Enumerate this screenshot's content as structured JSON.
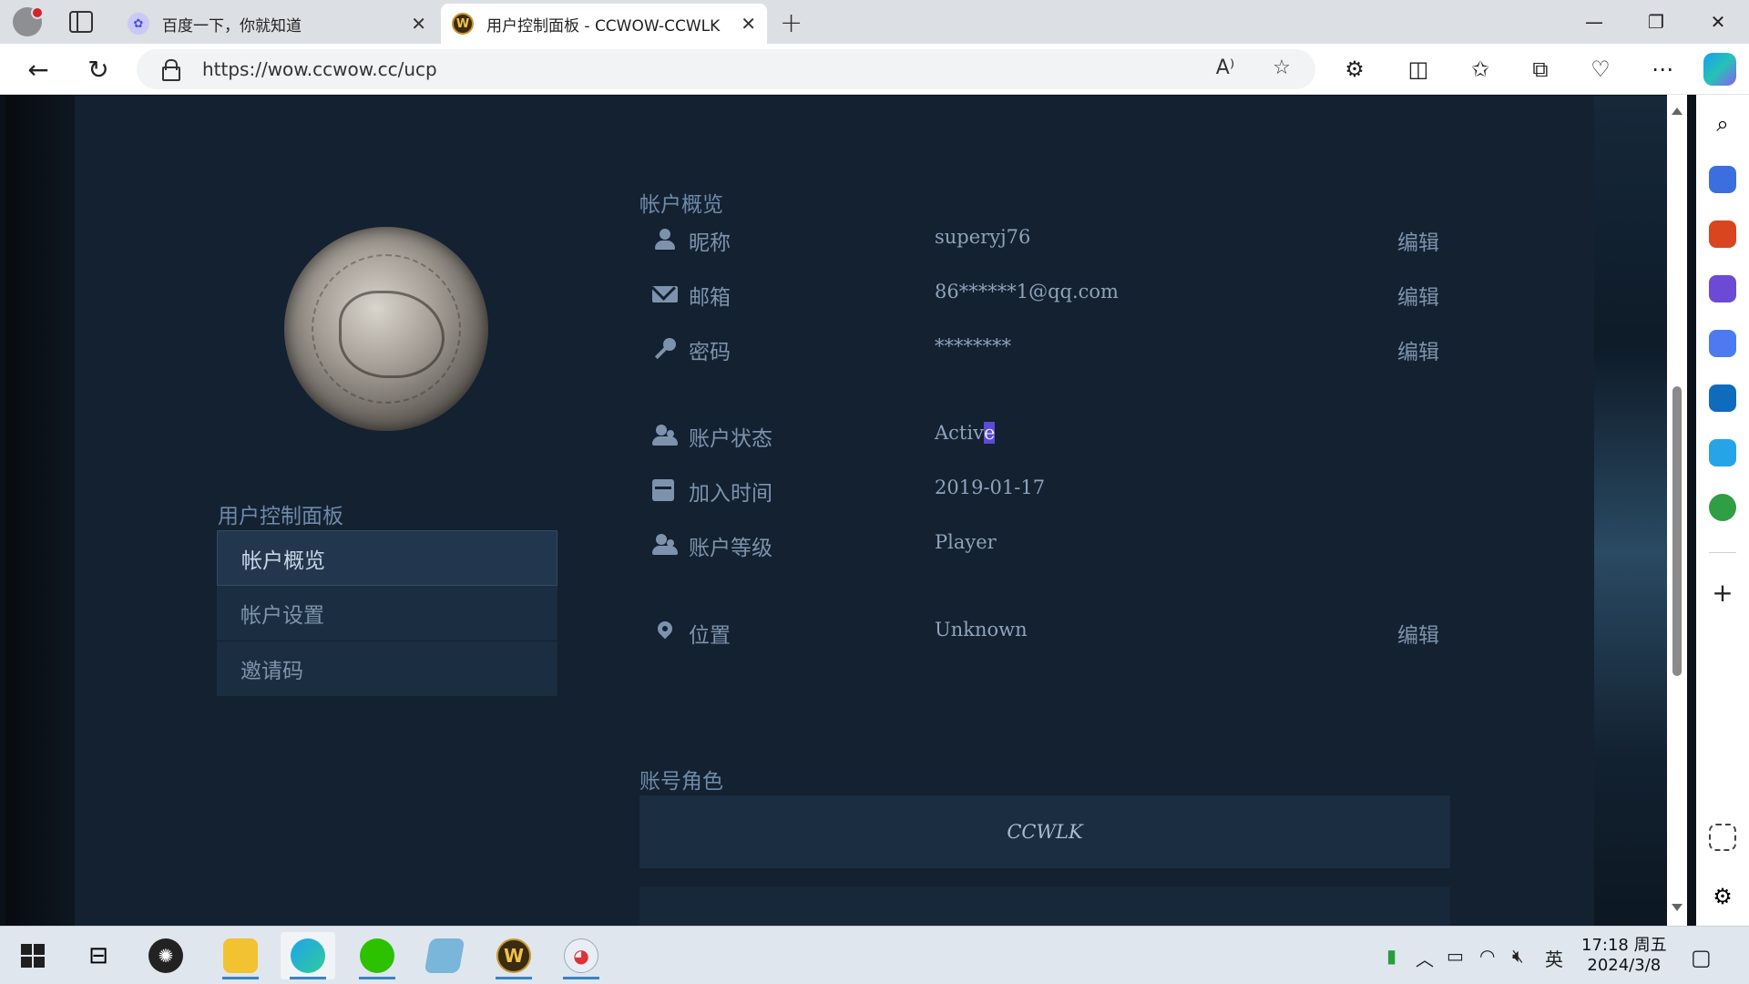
{
  "browser": {
    "tabs": [
      {
        "title": "百度一下，你就知道",
        "icon": "baidu-paw-icon"
      },
      {
        "title": "用户控制面板 - CCWOW-CCWLK",
        "icon": "wow-logo-icon"
      }
    ],
    "url": "https://wow.ccwow.cc/ucp"
  },
  "sidebar": {
    "heading": "用户控制面板",
    "items": [
      {
        "label": "帐户概览",
        "active": true
      },
      {
        "label": "帐户设置",
        "active": false
      },
      {
        "label": "邀请码",
        "active": false
      }
    ]
  },
  "overview": {
    "title": "帐户概览",
    "nickname": {
      "label": "昵称",
      "value": "superyj76",
      "edit": "编辑"
    },
    "email": {
      "label": "邮箱",
      "value": "86******1@qq.com",
      "edit": "编辑"
    },
    "password": {
      "label": "密码",
      "value": "********",
      "edit": "编辑"
    },
    "status": {
      "label": "账户状态",
      "value_plain": "Activ",
      "value_selected": "e"
    },
    "joined": {
      "label": "加入时间",
      "value": "2019-01-17"
    },
    "level": {
      "label": "账户等级",
      "value": "Player"
    },
    "location": {
      "label": "位置",
      "value": "Unknown",
      "edit": "编辑"
    }
  },
  "characters": {
    "title": "账号角色",
    "realm": "CCWLK"
  },
  "taskbar": {
    "time": "17:18 周五",
    "date": "2024/3/8",
    "ime": "英"
  },
  "colors": {
    "panel_bg": "#132131",
    "text_muted": "#7d93ad",
    "selection": "#5b4bd6"
  }
}
